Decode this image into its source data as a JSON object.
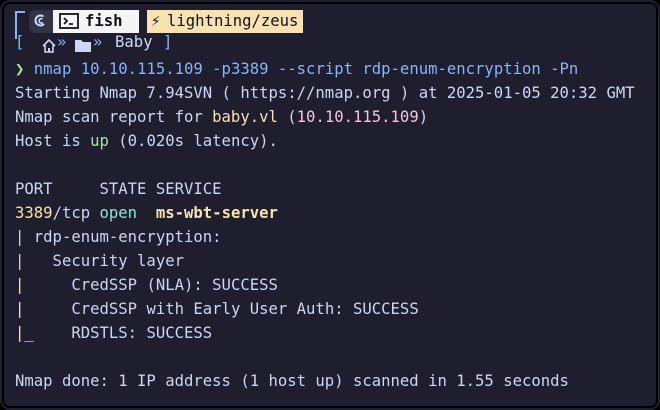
{
  "prompt": {
    "shell_name": "fish",
    "host_label": "lightning/zeus",
    "path_label": "Baby",
    "open_bracket": "[",
    "close_bracket": "]",
    "chevron": "❯"
  },
  "command": {
    "program": "nmap",
    "args": "10.10.115.109 -p3389 --script rdp-enum-encryption -Pn"
  },
  "output": {
    "line_start": "Starting Nmap 7.94SVN ( https://nmap.org ) at 2025-01-05 20:32 GMT",
    "scan_report_prefix": "Nmap scan report for ",
    "scan_host": "baby.vl",
    "scan_ip_open": " (",
    "scan_ip": "10.10.115.109",
    "scan_ip_close": ")",
    "host_prefix": "Host is ",
    "host_state": "up",
    "host_suffix": " (0.020s latency).",
    "table_header": "PORT     STATE SERVICE",
    "port_num": "3389",
    "port_proto": "/tcp",
    "port_state": "open",
    "port_service": "ms-wbt-server",
    "script_name": "| rdp-enum-encryption:",
    "security_layer": "|   Security layer",
    "cred_nla": "CredSSP (NLA): SUCCESS",
    "cred_early": "CredSSP with Early User Auth: SUCCESS",
    "rdstls": "RDSTLS: SUCCESS",
    "done": "Nmap done: 1 IP address (1 host up) scanned in 1.55 seconds"
  },
  "colors": {
    "background": "#1e1e2e",
    "accent_blue": "#89b4fa",
    "green": "#a6e3a1",
    "yellow": "#f9e2af",
    "pink": "#f5c2e7"
  }
}
